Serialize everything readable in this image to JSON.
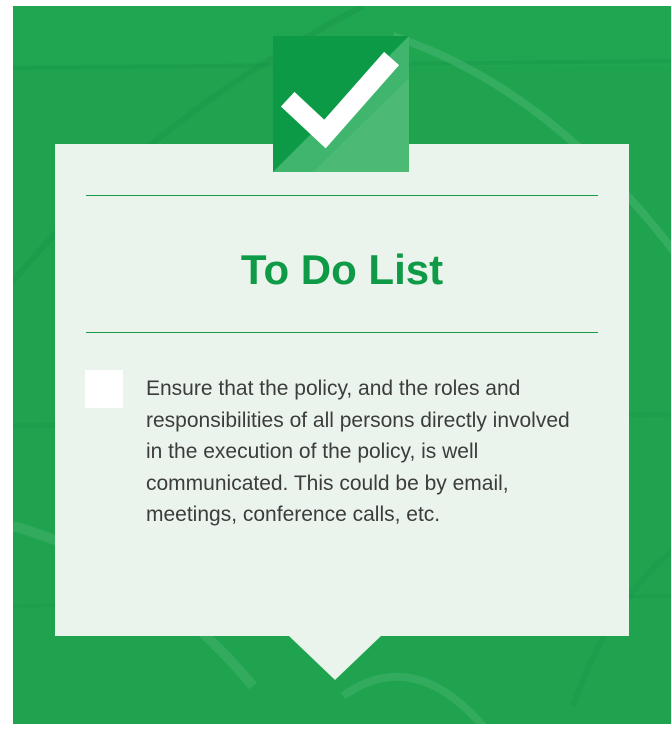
{
  "title": "To Do List",
  "items": [
    {
      "checked": false,
      "text": "Ensure that the policy, and the roles and responsibilities of all persons directly involved in the execution of the policy, is well communicated. This could be by email, meetings, conference calls, etc."
    }
  ],
  "colors": {
    "background": "#1fa34e",
    "card": "#eaf4ec",
    "accent": "#0e9a47",
    "text": "#3c3c3c"
  },
  "icons": {
    "badge": "checkmark-icon",
    "item_box": "checkbox-icon"
  }
}
